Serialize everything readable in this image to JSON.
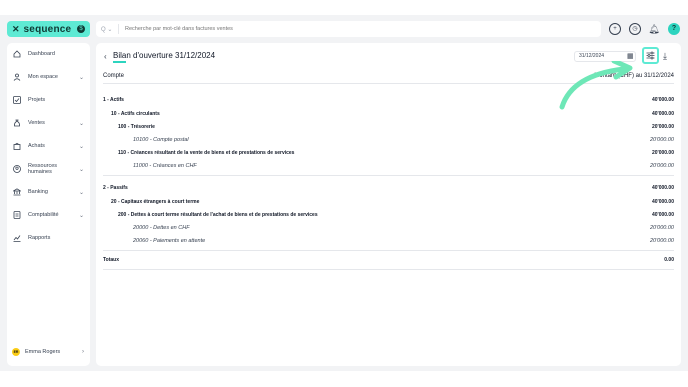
{
  "brand": {
    "name": "sequence",
    "badge": "$"
  },
  "search": {
    "scope": "Q",
    "placeholder": "Recherche par mot-clé dans factures ventes"
  },
  "topbar": {
    "help": "?"
  },
  "sidebar": {
    "items": [
      {
        "label": "Dashboard",
        "chevron": false
      },
      {
        "label": "Mon espace",
        "chevron": true
      },
      {
        "label": "Projets",
        "chevron": false
      },
      {
        "label": "Ventes",
        "chevron": true
      },
      {
        "label": "Achats",
        "chevron": true
      },
      {
        "label": "Ressources humaines",
        "chevron": true
      },
      {
        "label": "Banking",
        "chevron": true
      },
      {
        "label": "Comptabilité",
        "chevron": true
      },
      {
        "label": "Rapports",
        "chevron": false
      }
    ],
    "user": {
      "initials": "ER",
      "name": "Emma Rogers"
    }
  },
  "page": {
    "title": "Bilan d'ouverture 31/12/2024",
    "date_chip": "31/12/2024",
    "col_account": "Compte",
    "col_amount": "Montant (CHF) au 31/12/2024"
  },
  "rows": [
    {
      "label": "1 - Actifs",
      "amount": "40'000.00",
      "style": "bold",
      "indent": 0
    },
    {
      "label": "10 - Actifs circulants",
      "amount": "40'000.00",
      "style": "bold",
      "indent": 8
    },
    {
      "label": "100 - Trésorerie",
      "amount": "20'000.00",
      "style": "bold",
      "indent": 15
    },
    {
      "label": "10100 - Compte postal",
      "amount": "20'000.00",
      "style": "italic",
      "indent": 30
    },
    {
      "label": "110 - Créances résultant de la vente de biens et de prestations de services",
      "amount": "20'000.00",
      "style": "bold",
      "indent": 15
    },
    {
      "label": "11000 - Créances en CHF",
      "amount": "20'000.00",
      "style": "italic",
      "indent": 30
    },
    {
      "label": "2 - Passifs",
      "amount": "40'000.00",
      "style": "bold",
      "indent": 0
    },
    {
      "label": "20 - Capitaux étrangers à court terme",
      "amount": "40'000.00",
      "style": "bold",
      "indent": 8
    },
    {
      "label": "200 - Dettes à court terme résultant de l'achat de biens et de prestations de services",
      "amount": "40'000.00",
      "style": "bold",
      "indent": 15
    },
    {
      "label": "20000 - Dettes en CHF",
      "amount": "20'000.00",
      "style": "italic",
      "indent": 30
    },
    {
      "label": "20060 - Paiements en attente",
      "amount": "20'000.00",
      "style": "italic",
      "indent": 30
    },
    {
      "label": "Totaux",
      "amount": "0.00",
      "style": "bold",
      "indent": 0
    }
  ],
  "colors": {
    "accent": "#5eead4",
    "accent_dark": "#2dd4bf",
    "arrow": "#6ee7b7"
  }
}
